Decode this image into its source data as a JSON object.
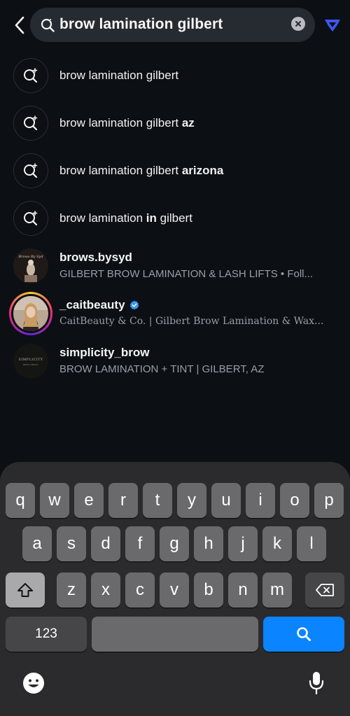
{
  "search": {
    "query": "brow lamination gilbert"
  },
  "suggestions": [
    {
      "prefix": "brow lamination gilbert",
      "bold": "",
      "suffix": ""
    },
    {
      "prefix": "brow lamination gilbert ",
      "bold": "az",
      "suffix": ""
    },
    {
      "prefix": "brow lamination gilbert ",
      "bold": "arizona",
      "suffix": ""
    },
    {
      "prefix": "brow lamination ",
      "bold": "in",
      "suffix": " gilbert"
    }
  ],
  "accounts": [
    {
      "username": "brows.bysyd",
      "subtitle": "GILBERT BROW LAMINATION & LASH LIFTS • Foll...",
      "verified": false,
      "story_ring": false,
      "avatar_text": "Brows By Syd"
    },
    {
      "username": "_caitbeauty",
      "subtitle": "CaitBeauty & Co. | Gilbert Brow Lamination & Wax...",
      "verified": true,
      "story_ring": true
    },
    {
      "username": "simplicity_brow",
      "subtitle": "BROW LAMINATION + TINT | GILBERT, AZ",
      "verified": false,
      "story_ring": false,
      "avatar_text": "SIMPLICITY",
      "avatar_subtext": "BROW & BEAUTY"
    }
  ],
  "keyboard": {
    "row1": [
      "q",
      "w",
      "e",
      "r",
      "t",
      "y",
      "u",
      "i",
      "o",
      "p"
    ],
    "row2": [
      "a",
      "s",
      "d",
      "f",
      "g",
      "h",
      "j",
      "k",
      "l"
    ],
    "row3": [
      "z",
      "x",
      "c",
      "v",
      "b",
      "n",
      "m"
    ],
    "numbers_label": "123",
    "space_label": "",
    "icons": {
      "shift": "shift-icon",
      "delete": "backspace-icon",
      "search": "search-icon",
      "emoji": "emoji-icon",
      "mic": "microphone-icon"
    }
  },
  "colors": {
    "accent": "#0a84ff",
    "verified": "#3897f0",
    "background": "#0c0f14"
  }
}
